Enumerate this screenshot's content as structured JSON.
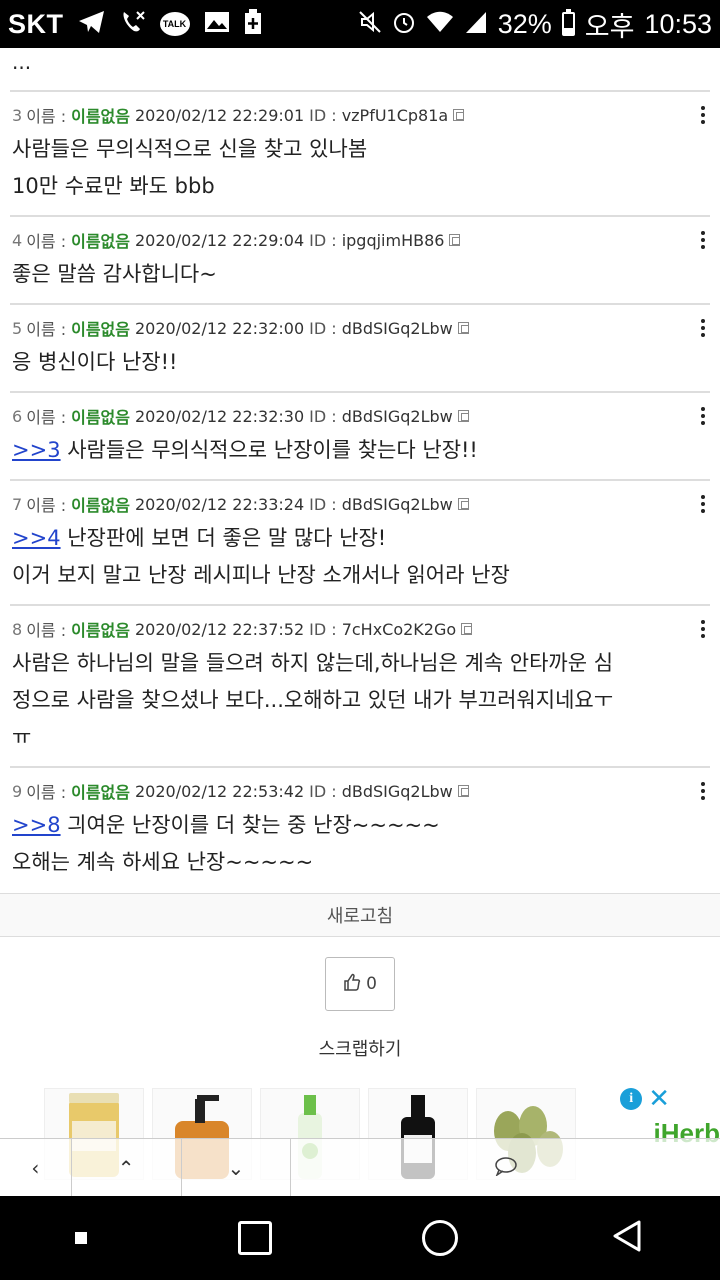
{
  "status_bar": {
    "carrier": "SKT",
    "battery": "32%",
    "battery_level": 0.32,
    "ampm": "오후",
    "time": "10:53",
    "talk_label": "TALK",
    "icons": [
      "telegram-icon",
      "missed-call-icon",
      "kakaotalk-icon",
      "gallery-icon",
      "battery-saver-icon",
      "mute-icon",
      "alarm-icon",
      "wifi-icon",
      "signal-icon",
      "battery-icon"
    ]
  },
  "thread": {
    "ellipsis": "...",
    "name_label": "이름 :",
    "id_label": "ID :",
    "comments": [
      {
        "num": "3",
        "name": "이름없음",
        "date": "2020/02/12 22:29:01",
        "id": "vzPfU1Cp81a",
        "anchor": "",
        "lines": [
          "사람들은 무의식적으로 신을 찾고 있나봄",
          "10만 수료만 봐도 bbb"
        ]
      },
      {
        "num": "4",
        "name": "이름없음",
        "date": "2020/02/12 22:29:04",
        "id": "ipgqjimHB86",
        "anchor": "",
        "lines": [
          "좋은 말씀 감사합니다~"
        ]
      },
      {
        "num": "5",
        "name": "이름없음",
        "date": "2020/02/12 22:32:00",
        "id": "dBdSIGq2Lbw",
        "anchor": "",
        "lines": [
          "응 병신이다 난장!!"
        ]
      },
      {
        "num": "6",
        "name": "이름없음",
        "date": "2020/02/12 22:32:30",
        "id": "dBdSIGq2Lbw",
        "anchor": ">>3",
        "lines": [
          " 사람들은 무의식적으로 난장이를 찾는다 난장!!"
        ]
      },
      {
        "num": "7",
        "name": "이름없음",
        "date": "2020/02/12 22:33:24",
        "id": "dBdSIGq2Lbw",
        "anchor": ">>4",
        "lines": [
          " 난장판에 보면 더 좋은 말 많다 난장!",
          "이거 보지 말고 난장 레시피나 난장 소개서나 읽어라 난장"
        ]
      },
      {
        "num": "8",
        "name": "이름없음",
        "date": "2020/02/12 22:37:52",
        "id": "7cHxCo2K2Go",
        "anchor": "",
        "lines": [
          "사람은 하나님의 말을 들으려 하지 않는데,하나님은 계속 안타까운 심",
          "정으로 사람을 찾으셨나 보다...오해하고 있던 내가 부끄러워지네요ㅜ",
          "ㅠ"
        ]
      },
      {
        "num": "9",
        "name": "이름없음",
        "date": "2020/02/12 22:53:42",
        "id": "dBdSIGq2Lbw",
        "anchor": ">>8",
        "lines": [
          " 긔여운 난장이를 더 찾는 중 난장~~~~~",
          "오해는 계속 하세요 난장~~~~~"
        ]
      }
    ]
  },
  "actions": {
    "refresh": "새로고침",
    "like_count": "0",
    "scrap": "스크랩하기"
  },
  "ad": {
    "brand": "iHerb",
    "info": "i",
    "close": "✕",
    "products": [
      "raw-honey",
      "liquid-soap",
      "aurora-drink",
      "mct-oil",
      "cardamom"
    ]
  },
  "toolbar": {
    "back": "‹",
    "up": "⌃",
    "down": "⌄"
  }
}
